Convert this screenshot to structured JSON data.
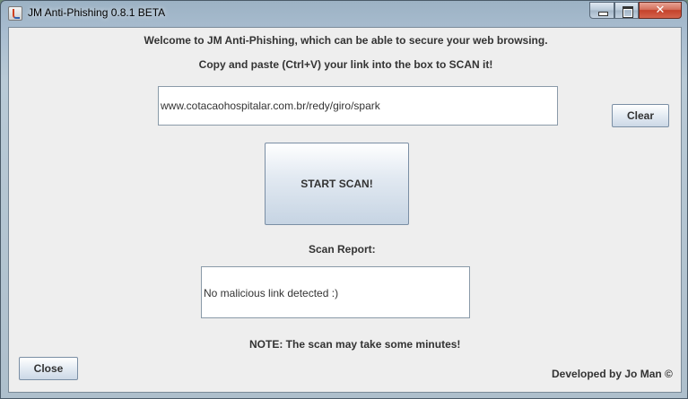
{
  "window": {
    "title": "JM Anti-Phishing 0.8.1 BETA"
  },
  "header": {
    "welcome": "Welcome to JM Anti-Phishing, which can be able to secure your web browsing.",
    "instruction": "Copy and paste (Ctrl+V) your link into the box to SCAN it!"
  },
  "scan": {
    "url_value": "www.cotacaohospitalar.com.br/redy/giro/spark",
    "clear_label": "Clear",
    "start_label": "START SCAN!"
  },
  "report": {
    "heading": "Scan Report:",
    "result": "No malicious link detected :)"
  },
  "footer": {
    "note": "NOTE: The scan may take some minutes!",
    "close_label": "Close",
    "developer": "Developed by Jo Man ©"
  },
  "icons": {
    "app": "java-app-icon",
    "minimize": "minimize-icon",
    "maximize": "maximize-icon",
    "close": "close-icon"
  }
}
